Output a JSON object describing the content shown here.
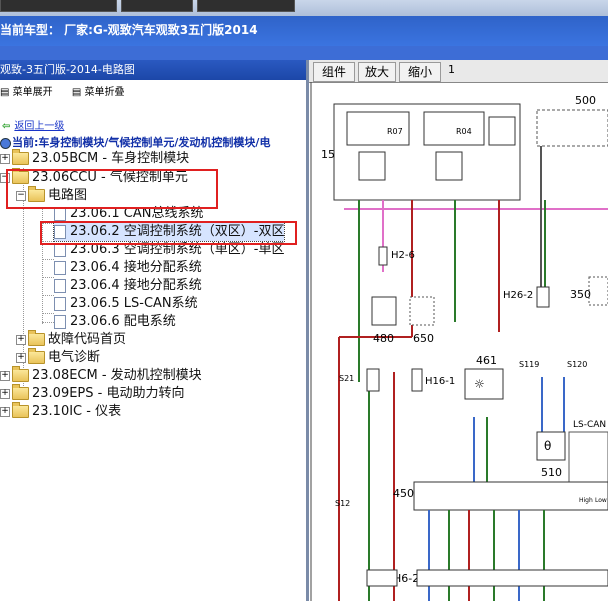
{
  "header": {
    "model_label": "当前车型：  厂家:G-观致汽车观致3五门版2014"
  },
  "left_panel": {
    "title": "观致-3五门版-2014-电路图",
    "menu_expand": "菜单展开",
    "menu_collapse": "菜单折叠",
    "back_link": "返回上一级",
    "path": "当前:车身控制模块/气候控制单元/发动机控制模块/电",
    "tree": [
      {
        "label": "23.05BCM - 车身控制模块",
        "expander": "+"
      },
      {
        "label": "23.06CCU - 气候控制单元",
        "expander": "−"
      },
      {
        "label": "电路图",
        "expander": "−"
      },
      {
        "label": "23.06.1 CAN总线系统"
      },
      {
        "label": "23.06.2 空调控制系统（双区）-双区"
      },
      {
        "label": "23.06.3 空调控制系统（单区）-单区"
      },
      {
        "label": "23.06.4 接地分配系统"
      },
      {
        "label": "23.06.4 接地分配系统"
      },
      {
        "label": "23.06.5 LS-CAN系统"
      },
      {
        "label": "23.06.6 配电系统"
      },
      {
        "label": "故障代码首页",
        "expander": "+"
      },
      {
        "label": "电气诊断",
        "expander": "+"
      },
      {
        "label": "23.08ECM - 发动机控制模块",
        "expander": "+"
      },
      {
        "label": "23.09EPS - 电动助力转向",
        "expander": "+"
      },
      {
        "label": "23.10IC - 仪表",
        "expander": "+"
      }
    ]
  },
  "right_panel": {
    "tabs": [
      "组件",
      "放大",
      "缩小"
    ],
    "page_number": "1",
    "diagram_labels": {
      "c15": "15",
      "r07": "R07",
      "r04": "R04",
      "c500": "500",
      "h2_6": "H2-6",
      "c480": "480",
      "c650": "650",
      "h26_2": "H26-2",
      "c350": "350",
      "c461": "461",
      "s21": "S21",
      "h16_1": "H16-1",
      "s119": "S119",
      "s120": "S120",
      "ls_can": "LS-CAN",
      "c510": "510",
      "c450": "450",
      "s12": "S12",
      "h6_2": "H6-2",
      "high": "High",
      "low": "Low"
    }
  },
  "colors": {
    "title_blue": "#2f63c9",
    "tree_highlight_box": "#e02020",
    "link_blue": "#1a35c8"
  }
}
